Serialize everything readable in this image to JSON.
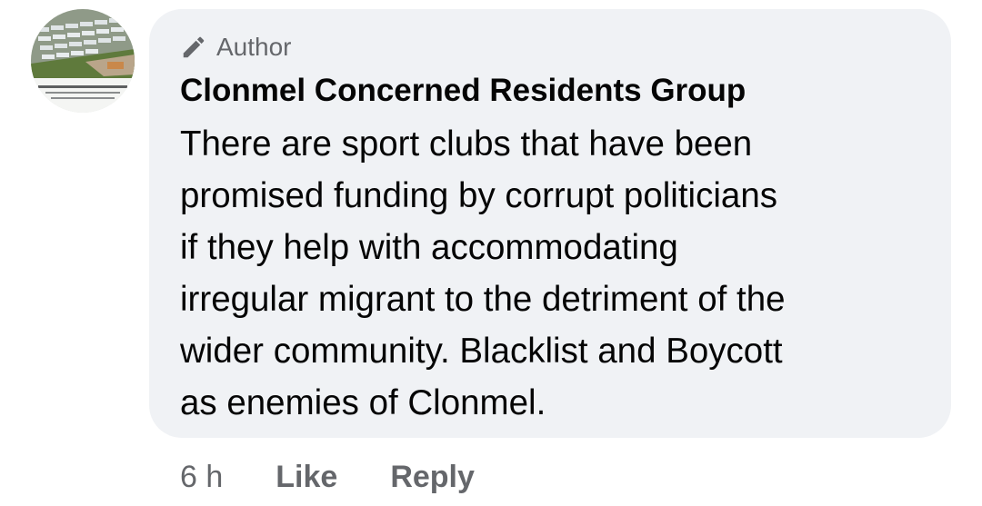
{
  "comment": {
    "badge": {
      "icon": "pencil-icon",
      "label": "Author"
    },
    "author_name": "Clonmel Concerned Residents Group",
    "text": "There are sport clubs that have been\npromised funding by corrupt politicians\nif they help with accommodating\nirregular migrant to the detriment of the\nwider community. Blacklist and Boycott\nas enemies of Clonmel.",
    "avatar_icon": "profile-picture-modular-buildings"
  },
  "actions": {
    "time": "6 h",
    "like_label": "Like",
    "reply_label": "Reply"
  },
  "colors": {
    "bubble_background": "#f0f2f5",
    "primary_text": "#050505",
    "secondary_text": "#65676b"
  }
}
